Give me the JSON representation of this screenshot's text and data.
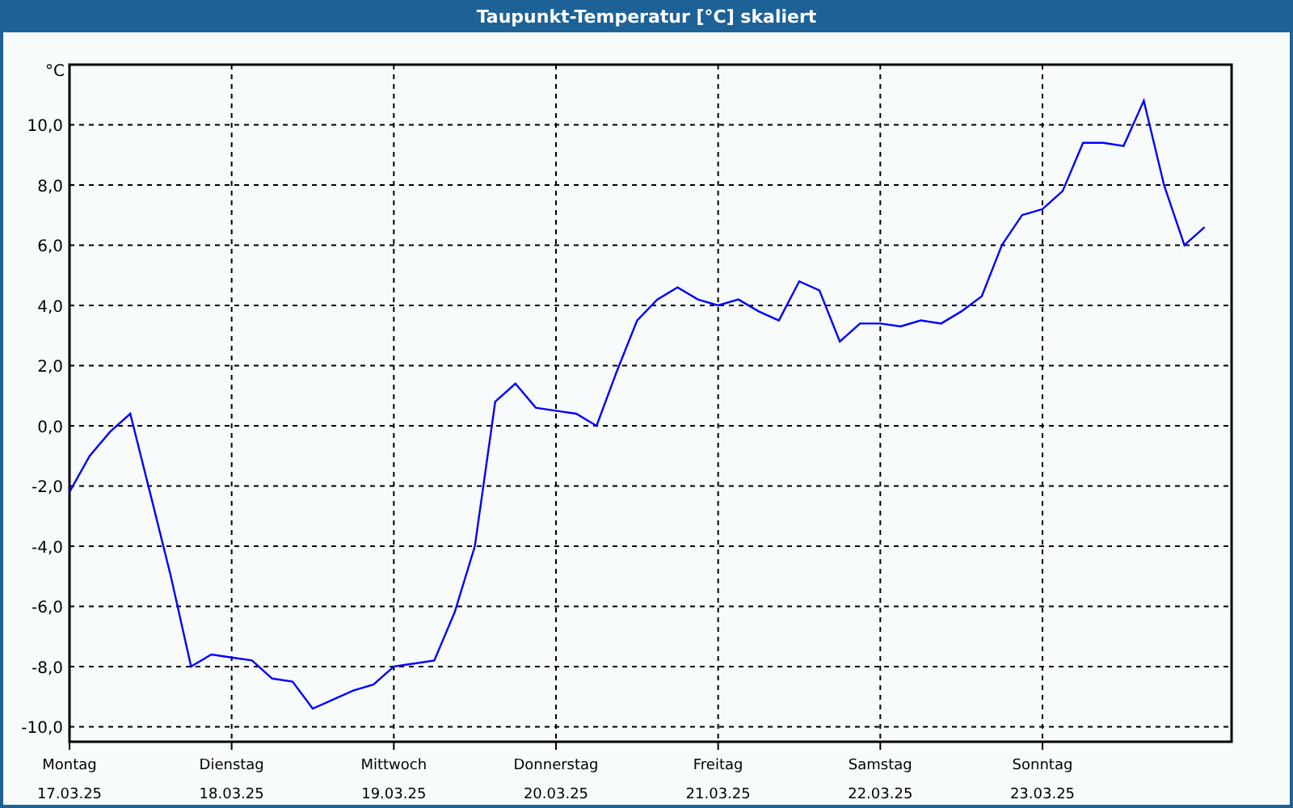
{
  "window": {
    "title": "Taupunkt-Temperatur [°C] skaliert"
  },
  "chart": {
    "dates": [
      "17.03.25",
      "18.03.25",
      "19.03.25",
      "20.03.25",
      "21.03.25",
      "22.03.25",
      "23.03.25"
    ],
    "chart_data": {
      "type": "line",
      "ylabel": "°C",
      "ylim": [
        -10.5,
        12
      ],
      "grid": true,
      "categories": [
        "Montag",
        null,
        null,
        null,
        null,
        null,
        null,
        null,
        "Dienstag",
        null,
        null,
        null,
        null,
        null,
        null,
        null,
        "Mittwoch",
        null,
        null,
        null,
        null,
        null,
        null,
        null,
        "Donnerstag",
        null,
        null,
        null,
        null,
        null,
        null,
        null,
        "Freitag",
        null,
        null,
        null,
        null,
        null,
        null,
        null,
        "Samstag",
        null,
        null,
        null,
        null,
        null,
        null,
        null,
        "Sonntag",
        null,
        null,
        null,
        null,
        null,
        null,
        null,
        null
      ],
      "yticks": [
        {
          "value": -10,
          "label": "-10,0"
        },
        {
          "value": -8,
          "label": "-8,0"
        },
        {
          "value": -6,
          "label": "-6,0"
        },
        {
          "value": -4,
          "label": "-4,0"
        },
        {
          "value": -2,
          "label": "-2,0"
        },
        {
          "value": 0,
          "label": "0,0"
        },
        {
          "value": 2,
          "label": "2,0"
        },
        {
          "value": 4,
          "label": "4,0"
        },
        {
          "value": 6,
          "label": "6,0"
        },
        {
          "value": 8,
          "label": "8,0"
        },
        {
          "value": 10,
          "label": "10,0"
        }
      ],
      "series": [
        {
          "color": "#0000ff",
          "values": [
            -2.2,
            -1.0,
            -0.2,
            0.4,
            -2.3,
            -5.0,
            -8.0,
            -7.6,
            -7.7,
            -7.8,
            -8.4,
            -8.5,
            -9.4,
            -9.1,
            -8.8,
            -8.6,
            -8.0,
            -7.9,
            -7.8,
            -6.2,
            -4.0,
            0.8,
            1.4,
            0.6,
            0.5,
            0.4,
            0.0,
            1.8,
            3.5,
            4.2,
            4.6,
            4.2,
            4.0,
            4.2,
            3.8,
            3.5,
            4.8,
            4.5,
            2.8,
            3.4,
            3.4,
            3.3,
            3.5,
            3.4,
            3.8,
            4.3,
            6.0,
            7.0,
            7.2,
            7.8,
            9.4,
            9.4,
            9.3,
            10.8,
            8.0,
            6.0,
            6.6
          ]
        }
      ]
    }
  }
}
